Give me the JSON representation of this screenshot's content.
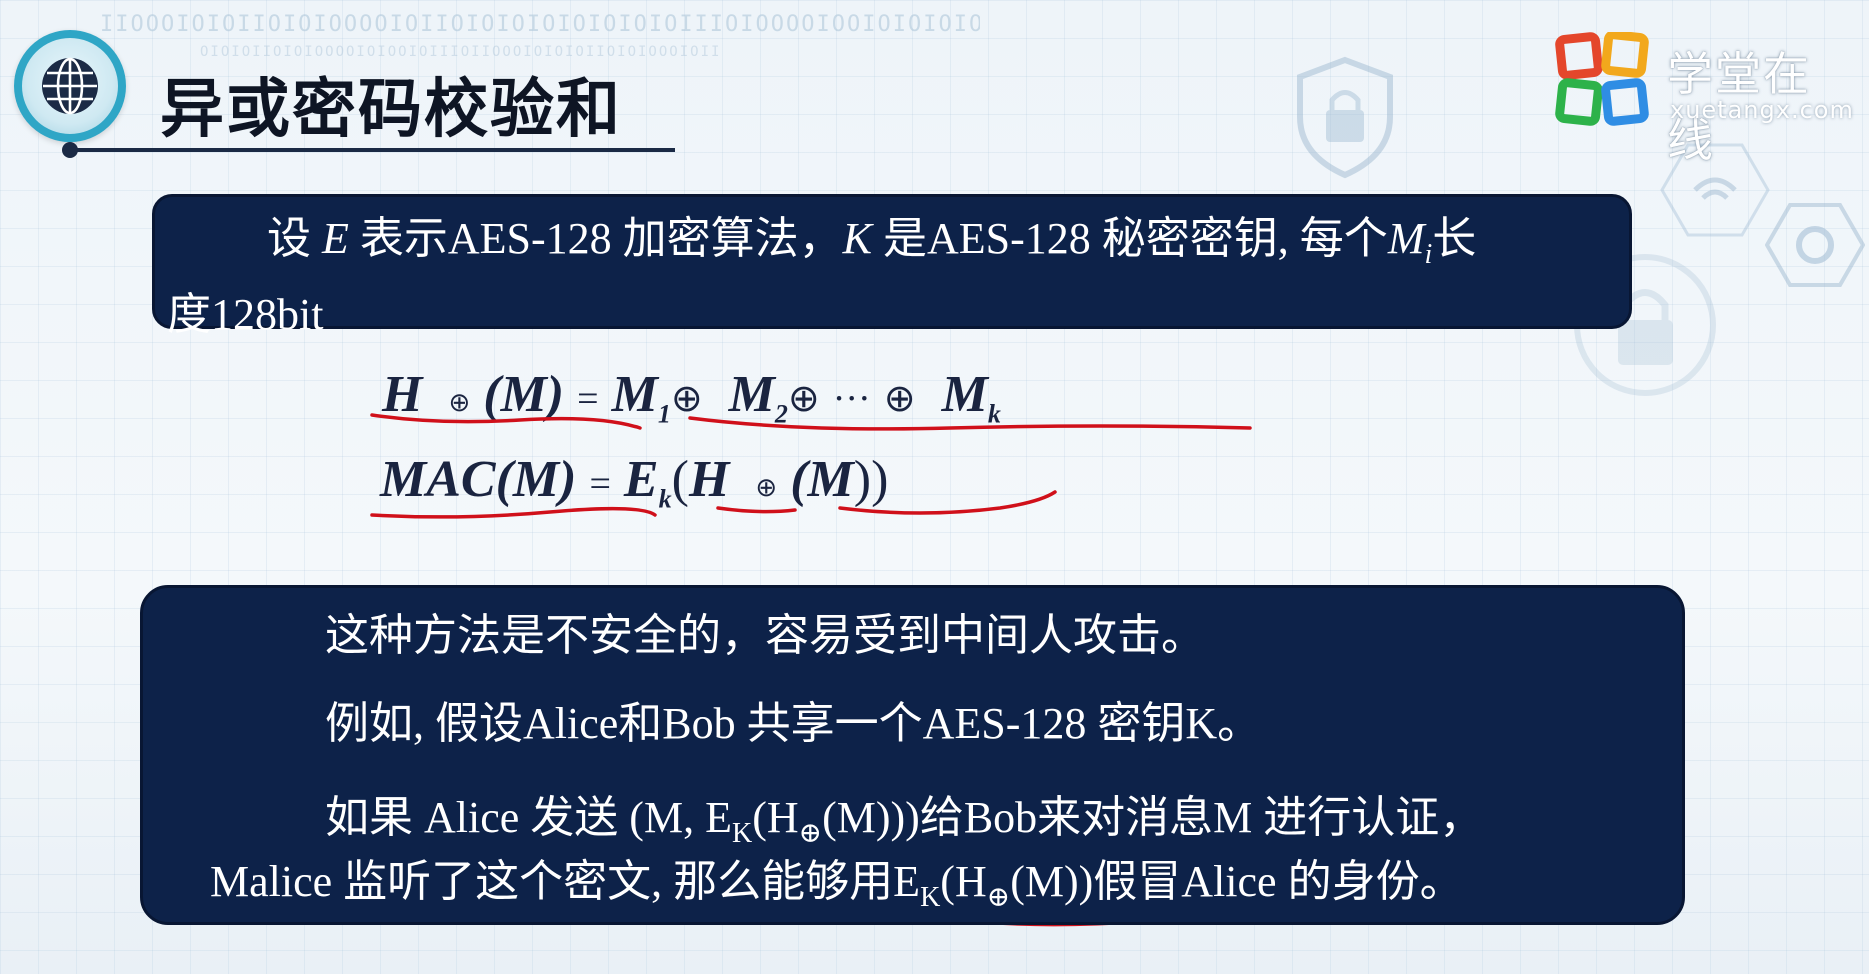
{
  "header": {
    "title": "异或密码校验和",
    "logo_cn": "学堂在线",
    "logo_en": "xuetangx.com",
    "binary_decor": "IIOOOIOIOIIOIOIOOOOIOIIOIOIOIOIOIOIOIOIIIOIOOOOIOOIOIOIOIOIIOOOIOIIOIOIOOO",
    "binary_decor_2": "OIOIOIIOIOIOOOOIOIOOIOIIIOIIOOOIOIOIOIIOIOIOOOIOIIOOOIOIIOIOIO"
  },
  "definition": {
    "part1": "设",
    "E": "E",
    "part2": "表示AES-128 加密算法，",
    "K": "K",
    "part3": "是AES-128 秘密密钥, 每个",
    "M": "M",
    "M_sub": "i",
    "part4": "长",
    "line2": "度128bit"
  },
  "formulas": {
    "f1": {
      "H": "H",
      "oplus_small": "⊕",
      "lhs_arg": "(M)",
      "eq": "=",
      "M1": "M",
      "sub1": "1",
      "oplus": "⊕",
      "M2": "M",
      "sub2": "2",
      "dots": "···",
      "Mk": "M",
      "subk": "k"
    },
    "f2": {
      "mac": "MAC",
      "arg": "(M)",
      "eq": "=",
      "E": "E",
      "subk": "k",
      "open": "(",
      "H": "H",
      "oplus_small": "⊕",
      "inner": "(M",
      "close": "))"
    }
  },
  "attack_box": {
    "line1": "这种方法是不安全的，容易受到中间人攻击。",
    "line2": "例如, 假设Alice和Bob 共享一个AES-128 密钥K。",
    "line3_a": "如果 Alice 发送 ",
    "line3_b": "(M, E",
    "line3_sub": "K",
    "line3_c": "(H",
    "line3_oplus": "⊕",
    "line3_d": "(M)))",
    "line3_e": "给Bob来对消息M 进行认证，",
    "line4_a": "Malice 监听了这个密文, 那么能够用",
    "line4_b": "E",
    "line4_sub": "K",
    "line4_c": "(H",
    "line4_oplus": "⊕",
    "line4_d": "(M))",
    "line4_e": "假冒Alice 的身份。"
  },
  "colors": {
    "box_bg": "#0d2249",
    "annotation_red": "#d0101a",
    "title_text": "#0e1524",
    "globe_ring": "#2fa6c6"
  }
}
